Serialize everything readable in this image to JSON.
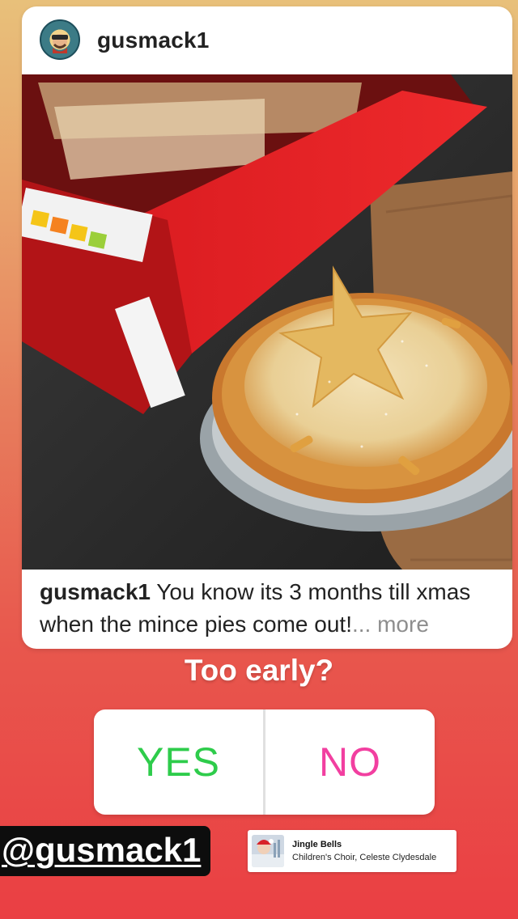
{
  "post": {
    "username": "gusmack1",
    "caption_user": "gusmack1",
    "caption_text": " You know its 3 months till xmas when the mince pies come out!",
    "caption_more": "... more",
    "photo_subject": "mince pie with star pastry top next to red box"
  },
  "poll": {
    "question": "Too early?",
    "options": [
      "YES",
      "NO"
    ]
  },
  "mention": {
    "label": "@gusmack1"
  },
  "music": {
    "title": "Jingle Bells",
    "artist": "Children's Choir, Celeste Clydesdale"
  },
  "colors": {
    "yes": "#2ecc4b",
    "no": "#f23fa0",
    "background_top": "#e8c07a",
    "background_bottom": "#ea3f43"
  }
}
